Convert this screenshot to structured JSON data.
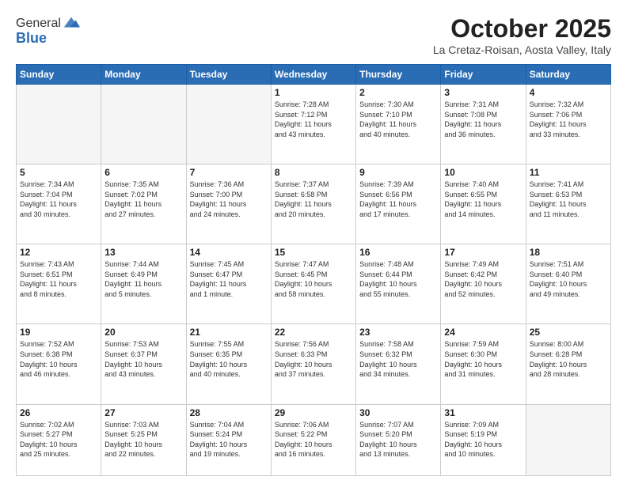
{
  "header": {
    "logo_general": "General",
    "logo_blue": "Blue",
    "title": "October 2025",
    "subtitle": "La Cretaz-Roisan, Aosta Valley, Italy"
  },
  "weekdays": [
    "Sunday",
    "Monday",
    "Tuesday",
    "Wednesday",
    "Thursday",
    "Friday",
    "Saturday"
  ],
  "weeks": [
    [
      {
        "day": "",
        "info": ""
      },
      {
        "day": "",
        "info": ""
      },
      {
        "day": "",
        "info": ""
      },
      {
        "day": "1",
        "info": "Sunrise: 7:28 AM\nSunset: 7:12 PM\nDaylight: 11 hours\nand 43 minutes."
      },
      {
        "day": "2",
        "info": "Sunrise: 7:30 AM\nSunset: 7:10 PM\nDaylight: 11 hours\nand 40 minutes."
      },
      {
        "day": "3",
        "info": "Sunrise: 7:31 AM\nSunset: 7:08 PM\nDaylight: 11 hours\nand 36 minutes."
      },
      {
        "day": "4",
        "info": "Sunrise: 7:32 AM\nSunset: 7:06 PM\nDaylight: 11 hours\nand 33 minutes."
      }
    ],
    [
      {
        "day": "5",
        "info": "Sunrise: 7:34 AM\nSunset: 7:04 PM\nDaylight: 11 hours\nand 30 minutes."
      },
      {
        "day": "6",
        "info": "Sunrise: 7:35 AM\nSunset: 7:02 PM\nDaylight: 11 hours\nand 27 minutes."
      },
      {
        "day": "7",
        "info": "Sunrise: 7:36 AM\nSunset: 7:00 PM\nDaylight: 11 hours\nand 24 minutes."
      },
      {
        "day": "8",
        "info": "Sunrise: 7:37 AM\nSunset: 6:58 PM\nDaylight: 11 hours\nand 20 minutes."
      },
      {
        "day": "9",
        "info": "Sunrise: 7:39 AM\nSunset: 6:56 PM\nDaylight: 11 hours\nand 17 minutes."
      },
      {
        "day": "10",
        "info": "Sunrise: 7:40 AM\nSunset: 6:55 PM\nDaylight: 11 hours\nand 14 minutes."
      },
      {
        "day": "11",
        "info": "Sunrise: 7:41 AM\nSunset: 6:53 PM\nDaylight: 11 hours\nand 11 minutes."
      }
    ],
    [
      {
        "day": "12",
        "info": "Sunrise: 7:43 AM\nSunset: 6:51 PM\nDaylight: 11 hours\nand 8 minutes."
      },
      {
        "day": "13",
        "info": "Sunrise: 7:44 AM\nSunset: 6:49 PM\nDaylight: 11 hours\nand 5 minutes."
      },
      {
        "day": "14",
        "info": "Sunrise: 7:45 AM\nSunset: 6:47 PM\nDaylight: 11 hours\nand 1 minute."
      },
      {
        "day": "15",
        "info": "Sunrise: 7:47 AM\nSunset: 6:45 PM\nDaylight: 10 hours\nand 58 minutes."
      },
      {
        "day": "16",
        "info": "Sunrise: 7:48 AM\nSunset: 6:44 PM\nDaylight: 10 hours\nand 55 minutes."
      },
      {
        "day": "17",
        "info": "Sunrise: 7:49 AM\nSunset: 6:42 PM\nDaylight: 10 hours\nand 52 minutes."
      },
      {
        "day": "18",
        "info": "Sunrise: 7:51 AM\nSunset: 6:40 PM\nDaylight: 10 hours\nand 49 minutes."
      }
    ],
    [
      {
        "day": "19",
        "info": "Sunrise: 7:52 AM\nSunset: 6:38 PM\nDaylight: 10 hours\nand 46 minutes."
      },
      {
        "day": "20",
        "info": "Sunrise: 7:53 AM\nSunset: 6:37 PM\nDaylight: 10 hours\nand 43 minutes."
      },
      {
        "day": "21",
        "info": "Sunrise: 7:55 AM\nSunset: 6:35 PM\nDaylight: 10 hours\nand 40 minutes."
      },
      {
        "day": "22",
        "info": "Sunrise: 7:56 AM\nSunset: 6:33 PM\nDaylight: 10 hours\nand 37 minutes."
      },
      {
        "day": "23",
        "info": "Sunrise: 7:58 AM\nSunset: 6:32 PM\nDaylight: 10 hours\nand 34 minutes."
      },
      {
        "day": "24",
        "info": "Sunrise: 7:59 AM\nSunset: 6:30 PM\nDaylight: 10 hours\nand 31 minutes."
      },
      {
        "day": "25",
        "info": "Sunrise: 8:00 AM\nSunset: 6:28 PM\nDaylight: 10 hours\nand 28 minutes."
      }
    ],
    [
      {
        "day": "26",
        "info": "Sunrise: 7:02 AM\nSunset: 5:27 PM\nDaylight: 10 hours\nand 25 minutes."
      },
      {
        "day": "27",
        "info": "Sunrise: 7:03 AM\nSunset: 5:25 PM\nDaylight: 10 hours\nand 22 minutes."
      },
      {
        "day": "28",
        "info": "Sunrise: 7:04 AM\nSunset: 5:24 PM\nDaylight: 10 hours\nand 19 minutes."
      },
      {
        "day": "29",
        "info": "Sunrise: 7:06 AM\nSunset: 5:22 PM\nDaylight: 10 hours\nand 16 minutes."
      },
      {
        "day": "30",
        "info": "Sunrise: 7:07 AM\nSunset: 5:20 PM\nDaylight: 10 hours\nand 13 minutes."
      },
      {
        "day": "31",
        "info": "Sunrise: 7:09 AM\nSunset: 5:19 PM\nDaylight: 10 hours\nand 10 minutes."
      },
      {
        "day": "",
        "info": ""
      }
    ]
  ]
}
